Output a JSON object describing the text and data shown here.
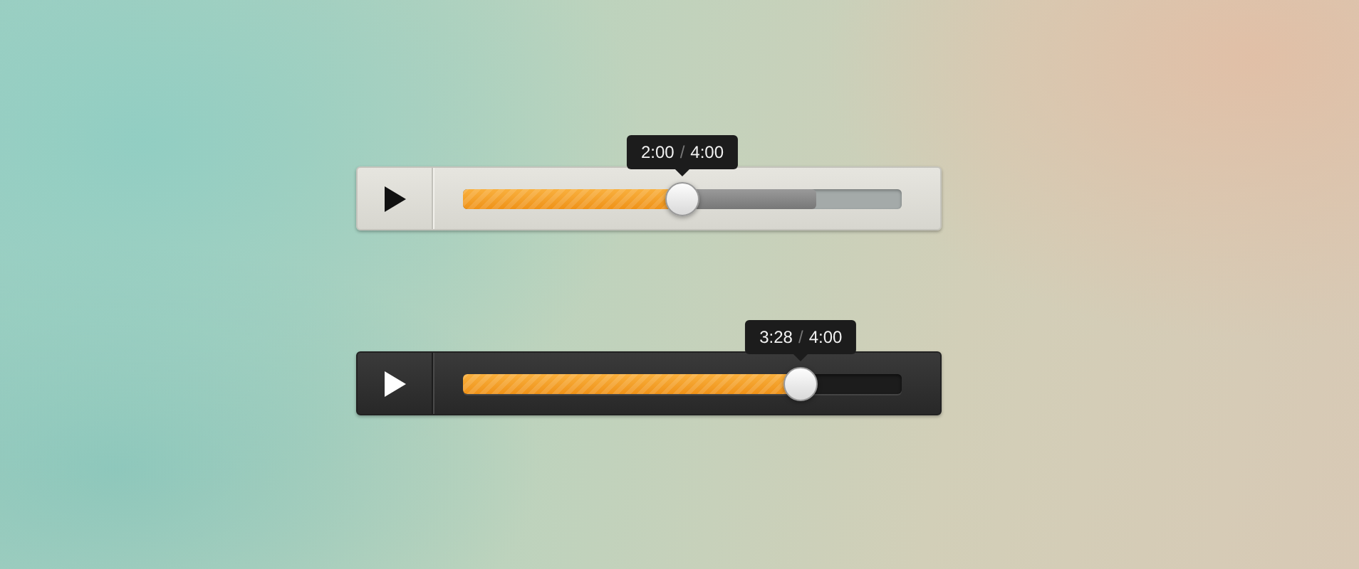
{
  "players": [
    {
      "kind": "light",
      "current": "2:00",
      "separator": "/",
      "total": "4:00",
      "level": 0.5,
      "buffer": {
        "level": 0.805
      }
    },
    {
      "kind": "dark",
      "current": "3:28",
      "separator": "/",
      "total": "4:00",
      "level": 0.77
    }
  ]
}
